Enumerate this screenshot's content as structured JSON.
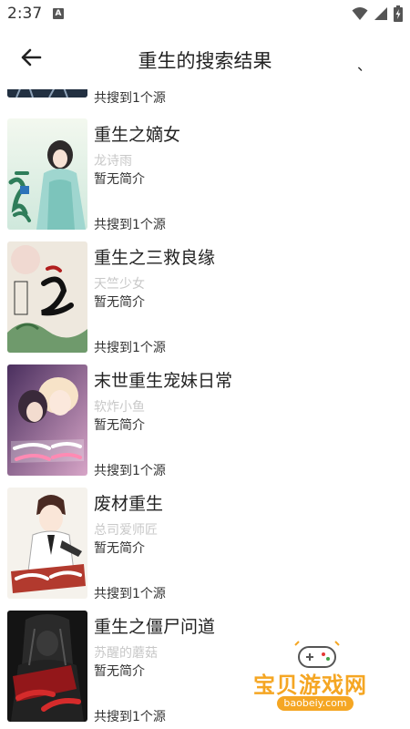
{
  "status_bar": {
    "time": "2:37",
    "notification_icon": "a-notification-icon",
    "wifi_icon": "wifi-icon",
    "signal_icon": "cellular-signal-icon",
    "battery_icon": "battery-charging-icon"
  },
  "header": {
    "back_icon": "arrow-left-icon",
    "title": "重生的搜索结果",
    "menu_mark": "、"
  },
  "books": [
    {
      "title": "",
      "author": "",
      "desc": "",
      "source": "共搜到1个源",
      "cover_colors": [
        "#2e3a4a",
        "#4a5b70"
      ]
    },
    {
      "title": "重生之嫡女",
      "author": "龙诗雨",
      "desc": "暂无简介",
      "source": "共搜到1个源",
      "cover_colors": [
        "#e6f2e4",
        "#9fd0c2"
      ]
    },
    {
      "title": "重生之三救良缘",
      "author": "天竺少女",
      "desc": "暂无简介",
      "source": "共搜到1个源",
      "cover_colors": [
        "#efe8df",
        "#c9c0b5"
      ]
    },
    {
      "title": "末世重生宠妹日常",
      "author": "软炸小鱼",
      "desc": "暂无简介",
      "source": "共搜到1个源",
      "cover_colors": [
        "#3b2a4a",
        "#c98fb4"
      ]
    },
    {
      "title": "废材重生",
      "author": "总司爱师匠",
      "desc": "暂无简介",
      "source": "共搜到1个源",
      "cover_colors": [
        "#f4f1ea",
        "#b23a2e"
      ]
    },
    {
      "title": "重生之僵尸问道",
      "author": "苏醒的蘑菇",
      "desc": "暂无简介",
      "source": "共搜到1个源",
      "cover_colors": [
        "#151515",
        "#a0161a"
      ]
    }
  ],
  "watermark": {
    "text": "宝贝游戏网",
    "url": "baobeiy.com",
    "colors": {
      "text": "#f5a623"
    }
  }
}
